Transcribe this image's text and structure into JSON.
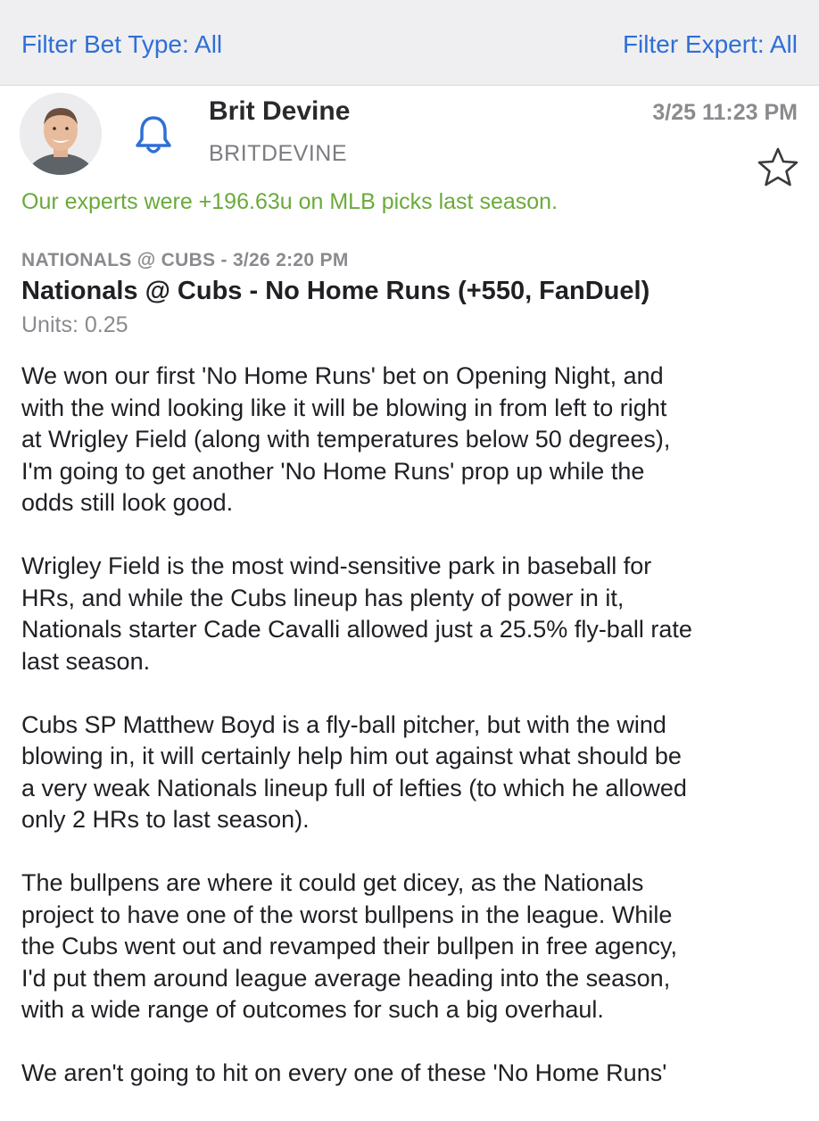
{
  "filters": {
    "bet_type_label": "Filter Bet Type: All",
    "expert_label": "Filter Expert: All"
  },
  "post": {
    "expert_name": "Brit Devine",
    "expert_handle": "BRITDEVINE",
    "timestamp": "3/25 11:23 PM",
    "promo": "Our experts were +196.63u on MLB picks last season.",
    "game_line": "NATIONALS @ CUBS - 3/26 2:20 PM",
    "pick_title": "Nationals @ Cubs - No Home Runs (+550, FanDuel)",
    "units": "Units: 0.25",
    "icons": {
      "bell": "bell-icon",
      "star": "star-icon",
      "avatar": "avatar"
    },
    "colors": {
      "link_blue": "#2f6fd6",
      "promo_green": "#6aaa3a",
      "muted_gray": "#8a8a8f"
    }
  },
  "analysis": {
    "paragraphs": [
      [
        "We won our first 'No Home Runs' bet on Opening Night, and",
        "with the wind looking like it will be blowing in from left to right",
        "at Wrigley Field (along with temperatures below 50 degrees),",
        "I'm going to get another 'No Home Runs' prop up while the",
        "odds still look good."
      ],
      [
        "Wrigley Field is the most wind-sensitive park in baseball for",
        "HRs, and while the Cubs lineup has plenty of power in it,",
        "Nationals starter Cade Cavalli allowed just a 25.5% fly-ball rate",
        "last season."
      ],
      [
        "Cubs SP Matthew Boyd is a fly-ball pitcher, but with the wind",
        "blowing in, it will certainly help him out against what should be",
        "a very weak Nationals lineup full of lefties (to which he allowed",
        "only 2 HRs to last season)."
      ],
      [
        "The bullpens are where it could get dicey, as the Nationals",
        "project to have one of the worst bullpens in the league. While",
        "the Cubs went out and revamped their bullpen in free agency,",
        "I'd put them around league average heading into the season,",
        "with a wide range of outcomes for such a big overhaul."
      ],
      [
        "We aren't going to hit on every one of these 'No Home Runs'"
      ]
    ]
  }
}
